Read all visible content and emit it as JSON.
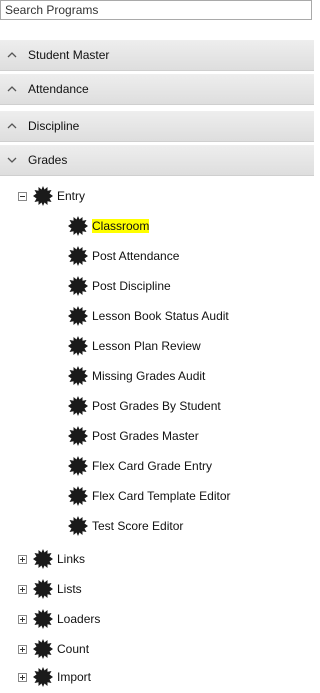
{
  "search": {
    "placeholder": "Search Programs"
  },
  "sections": [
    {
      "label": "Student Master",
      "state": "collapsed"
    },
    {
      "label": "Attendance",
      "state": "collapsed"
    },
    {
      "label": "Discipline",
      "state": "collapsed"
    },
    {
      "label": "Grades",
      "state": "expanded"
    }
  ],
  "tree": {
    "entry": {
      "label": "Entry",
      "items": [
        {
          "label": "Classroom",
          "selected": true
        },
        {
          "label": "Post Attendance"
        },
        {
          "label": "Post Discipline"
        },
        {
          "label": "Lesson Book Status Audit"
        },
        {
          "label": "Lesson Plan Review"
        },
        {
          "label": "Missing Grades Audit"
        },
        {
          "label": "Post Grades By Student"
        },
        {
          "label": "Post Grades Master"
        },
        {
          "label": "Flex Card Grade Entry"
        },
        {
          "label": "Flex Card Template Editor"
        },
        {
          "label": "Test Score Editor"
        }
      ]
    },
    "folders": [
      {
        "label": "Links"
      },
      {
        "label": "Lists"
      },
      {
        "label": "Loaders"
      },
      {
        "label": "Count"
      },
      {
        "label": "Import"
      }
    ]
  },
  "icons": {
    "section_collapsed": "chevron-up-icon",
    "section_expanded": "chevron-down-icon",
    "node": "gear-icon"
  },
  "colors": {
    "highlight": "#ffff00",
    "header_bg": "#e6e6e6",
    "gear": "#1a1a1a"
  }
}
